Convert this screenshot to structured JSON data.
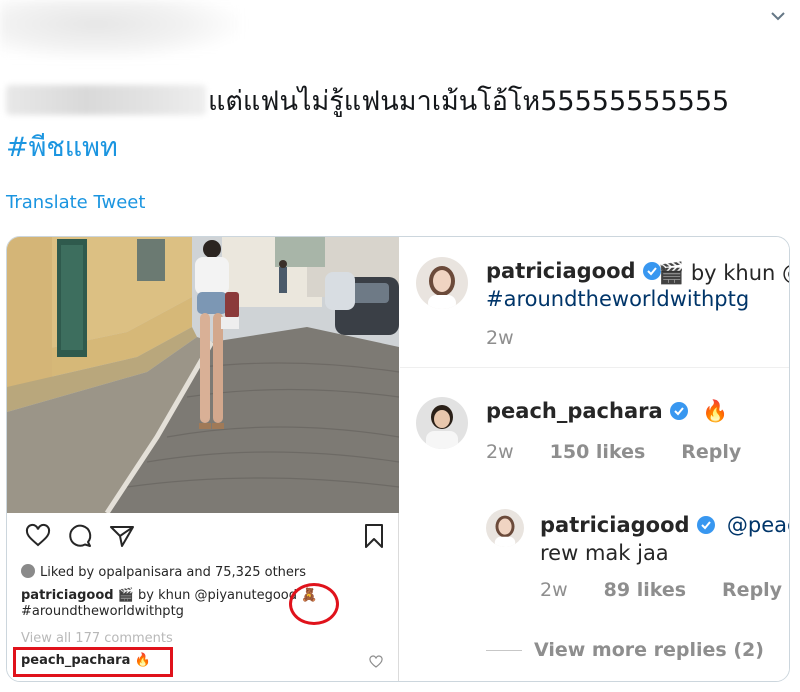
{
  "header": {
    "menu_icon": "chevron-down-icon"
  },
  "tweet": {
    "text": "แต่แฟนไม่รู้แฟนมาเม้นโอ้โห55555555555",
    "hashtag": "#พีชแพท",
    "translate_label": "Translate Tweet"
  },
  "post": {
    "liked_by": "Liked by opalpanisara and 75,325 others",
    "caption_user": "patriciagood",
    "caption_text": "🎬 by khun @piyanutegood 🧸",
    "caption_tag": "#aroundtheworldwithptg",
    "view_all": "View all 177 comments",
    "comment_user": "peach_pachara",
    "comment_emoji": "🔥",
    "icons": [
      "heart-icon",
      "comment-icon",
      "share-icon",
      "bookmark-icon"
    ]
  },
  "comments": {
    "c1": {
      "user": "patriciagood",
      "text": "🎬 by khun @",
      "tag": "#aroundtheworldwithptg",
      "time": "2w"
    },
    "c2": {
      "user": "peach_pachara",
      "text": "🔥",
      "time": "2w",
      "likes": "150 likes",
      "reply": "Reply"
    },
    "c3": {
      "user": "patriciagood",
      "mention": "@peach",
      "text": "rew mak jaa",
      "time": "2w",
      "likes": "89 likes",
      "reply": "Reply"
    },
    "view_more": "View more replies (2)"
  },
  "colors": {
    "twitter_blue": "#1b95e0",
    "highlight_red": "#e0121b",
    "verified_blue": "#3897f0"
  }
}
